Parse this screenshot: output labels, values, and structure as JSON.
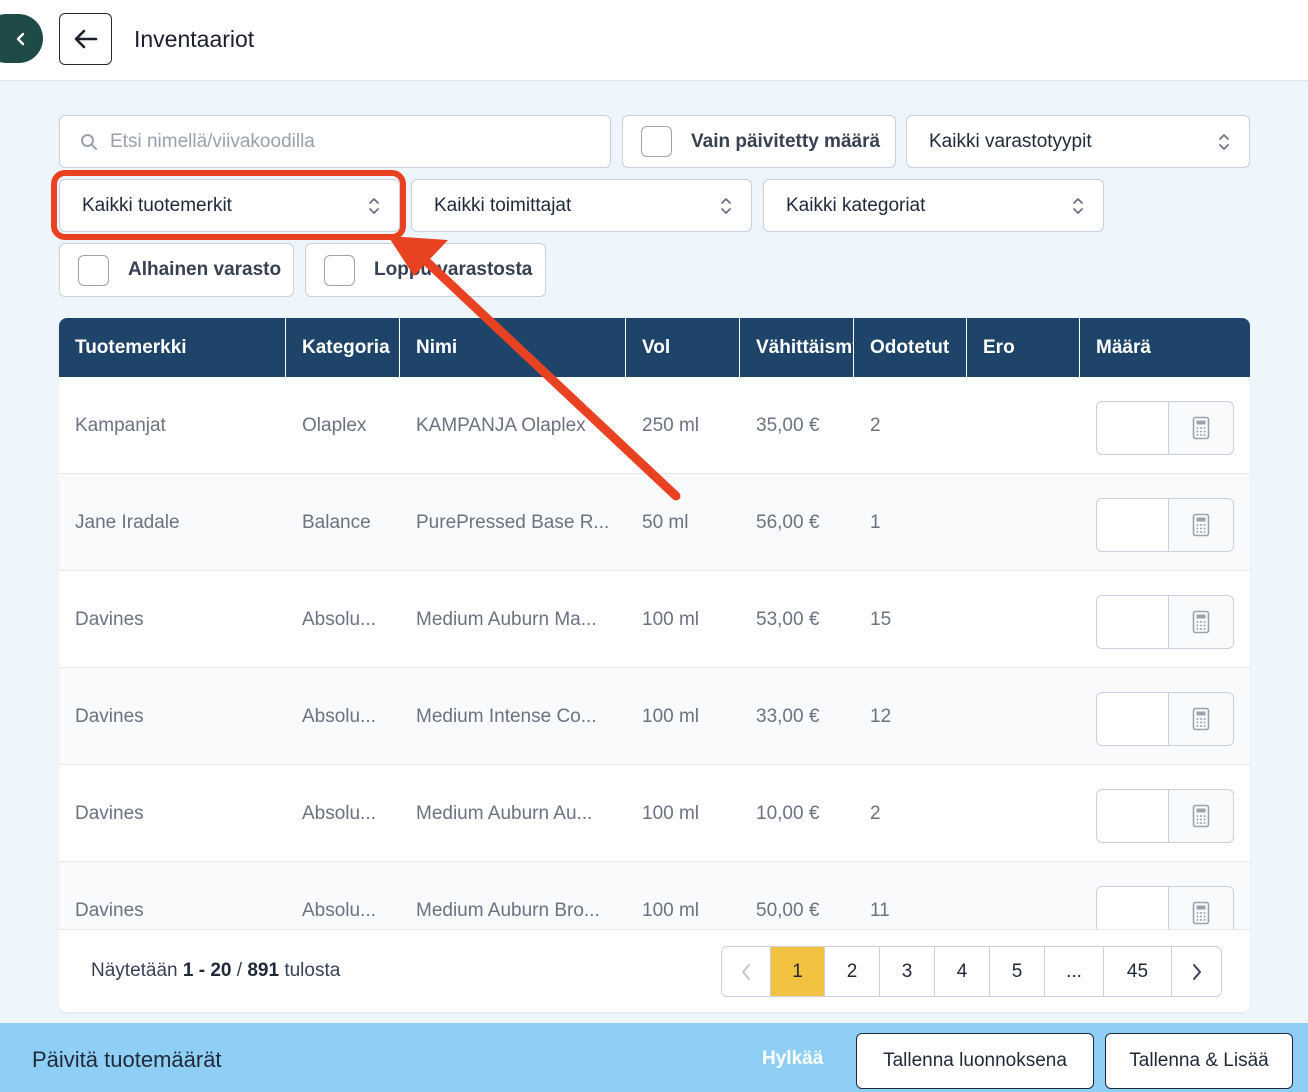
{
  "header": {
    "title": "Inventaariot"
  },
  "filters": {
    "search_placeholder": "Etsi nimellä/viivakoodilla",
    "only_updated_label": "Vain päivitetty määrä",
    "storage_type": "Kaikki varastotyypit",
    "brand": "Kaikki tuotemerkit",
    "supplier": "Kaikki toimittajat",
    "category": "Kaikki kategoriat",
    "low_stock_label": "Alhainen varasto",
    "out_of_stock_label": "Loppu varastosta"
  },
  "table": {
    "columns": [
      "Tuotemerkki",
      "Kategoria",
      "Nimi",
      "Vol",
      "Vähittäismyyntihinta",
      "Odotetut",
      "Ero",
      "Määrä"
    ],
    "rows": [
      {
        "brand": "Kampanjat",
        "category": "Olaplex",
        "name": "KAMPANJA Olaplex",
        "vol": "250 ml",
        "price": "35,00 €",
        "expected": "2",
        "diff": ""
      },
      {
        "brand": "Jane Iradale",
        "category": "Balance",
        "name": "PurePressed Base R...",
        "vol": "50 ml",
        "price": "56,00 €",
        "expected": "1",
        "diff": ""
      },
      {
        "brand": "Davines",
        "category": "Absolu...",
        "name": "Medium Auburn Ma...",
        "vol": "100 ml",
        "price": "53,00 €",
        "expected": "15",
        "diff": ""
      },
      {
        "brand": "Davines",
        "category": "Absolu...",
        "name": "Medium Intense Co...",
        "vol": "100 ml",
        "price": "33,00 €",
        "expected": "12",
        "diff": ""
      },
      {
        "brand": "Davines",
        "category": "Absolu...",
        "name": "Medium Auburn Au...",
        "vol": "100 ml",
        "price": "10,00 €",
        "expected": "2",
        "diff": ""
      },
      {
        "brand": "Davines",
        "category": "Absolu...",
        "name": "Medium Auburn Bro...",
        "vol": "100 ml",
        "price": "50,00 €",
        "expected": "11",
        "diff": ""
      }
    ]
  },
  "pagination": {
    "showing_prefix": "Näytetään ",
    "range": "1 - 20",
    "separator": " / ",
    "total": "891",
    "suffix": " tulosta",
    "pages": [
      "1",
      "2",
      "3",
      "4",
      "5",
      "...",
      "45"
    ],
    "active_page": "1"
  },
  "footer": {
    "title": "Päivitä tuotemäärät",
    "reject_label": "Hylkää",
    "save_draft_label": "Tallenna luonnoksena",
    "save_add_label": "Tallenna & Lisää"
  },
  "colors": {
    "header_bg": "#1e4569",
    "highlight": "#e84223",
    "active_page": "#f2c140",
    "bottom_bar": "#8fcff6"
  }
}
